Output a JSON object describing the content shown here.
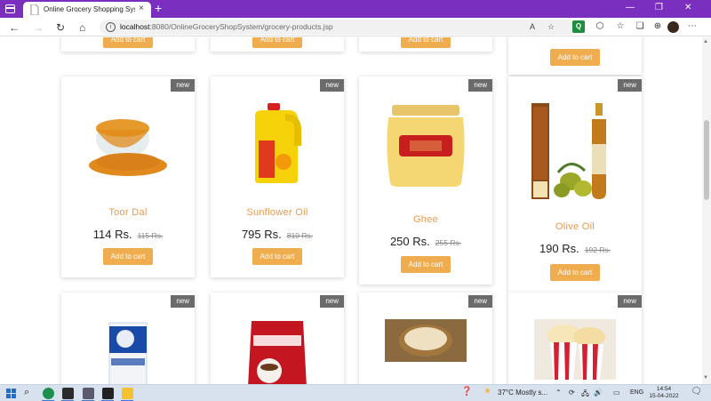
{
  "browser": {
    "tab_title": "Online Grocery Shopping System",
    "tab_close": "×",
    "new_tab": "+",
    "url_host": "localhost",
    "url_path": ":8080/OnlineGroceryShopSystem/grocery-products.jsp",
    "reader_icon": "A",
    "accent_color": "#7b2fbf"
  },
  "products": [
    {
      "name": "Toor Dal",
      "price": "114 Rs.",
      "old_price": "115 Rs.",
      "badge": "new",
      "button": "Add to cart",
      "image": "toor-dal-bowl"
    },
    {
      "name": "Sunflower Oil",
      "price": "795 Rs.",
      "old_price": "810 Rs.",
      "badge": "new",
      "button": "Add to cart",
      "image": "fortune-oil-can"
    },
    {
      "name": "Ghee",
      "price": "250 Rs.",
      "old_price": "255 Rs.",
      "badge": "new",
      "button": "Add to cart",
      "image": "ghee-jar"
    },
    {
      "name": "Olive Oil",
      "price": "190 Rs.",
      "old_price": "192 Rs.",
      "badge": "new",
      "button": "Add to cart",
      "image": "olive-oil-bottle"
    }
  ],
  "top_row_buttons": [
    "Add to cart",
    "Add to cart",
    "Add to cart",
    "Add to cart"
  ],
  "bottom_row": [
    {
      "badge": "new",
      "image": "tata-salt-pack"
    },
    {
      "badge": "new",
      "image": "nescafe-pack"
    },
    {
      "badge": "new",
      "image": "cashew-bowl"
    },
    {
      "badge": "new",
      "image": "popcorn-boxes"
    }
  ],
  "taskbar": {
    "weather": "37°C  Mostly s...",
    "language": "ENG",
    "time": "14:54",
    "date": "15-04-2022"
  },
  "colors": {
    "product_name": "#e8994a",
    "button": "#efad4f",
    "badge": "#6b6b6b"
  }
}
